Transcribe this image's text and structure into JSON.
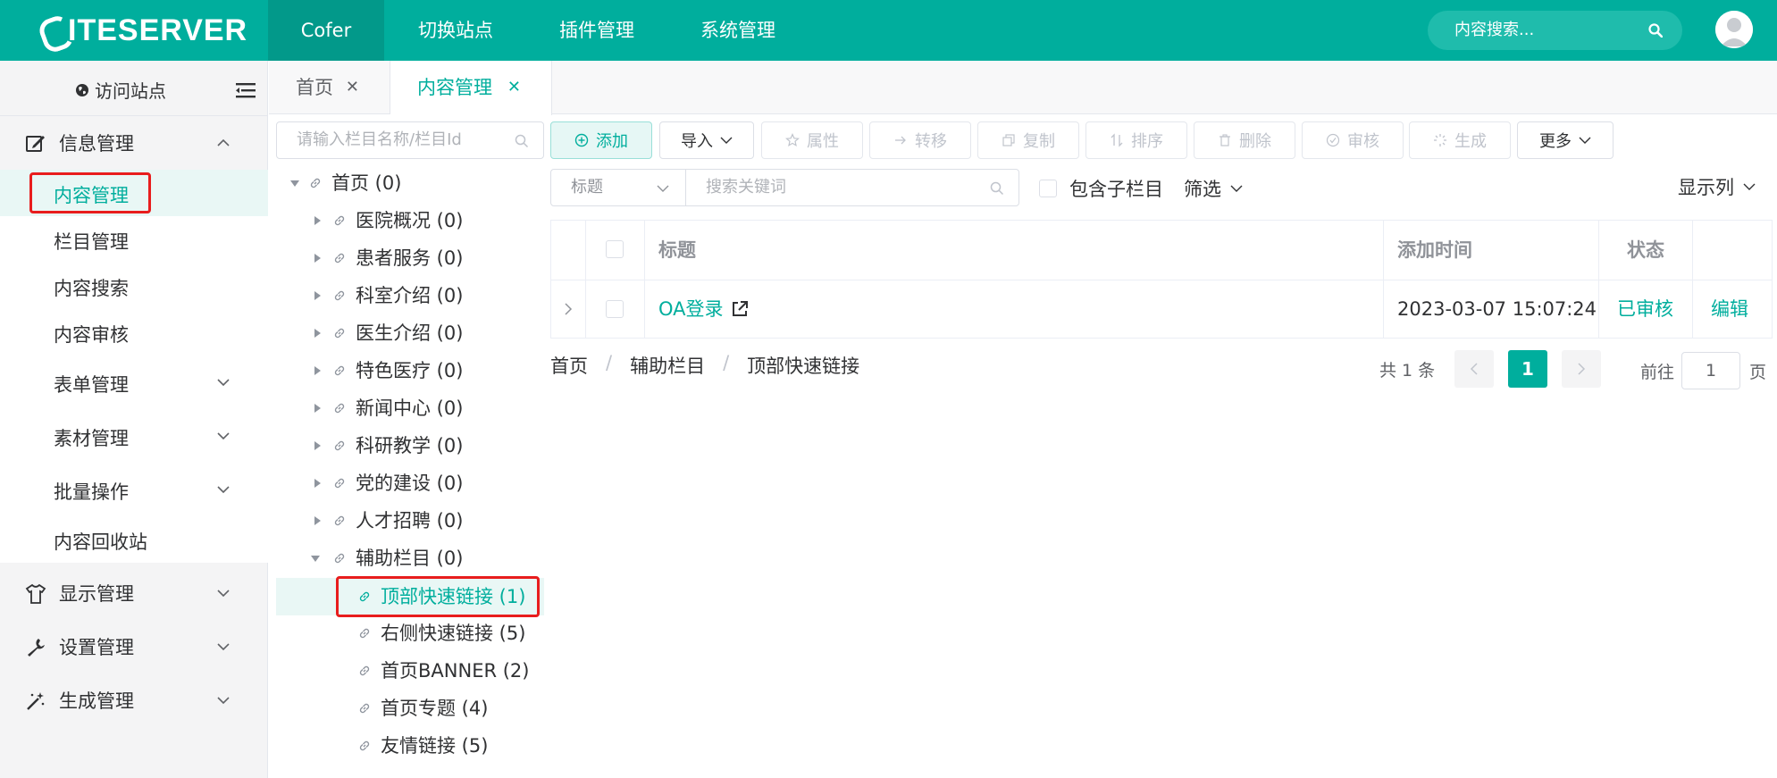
{
  "topbar": {
    "logo": "ITESERVER",
    "nav": [
      "Cofer",
      "切换站点",
      "插件管理",
      "系统管理"
    ],
    "search_placeholder": "内容搜索..."
  },
  "sidebar": {
    "visit_site": "访问站点",
    "groups": [
      {
        "label": "信息管理",
        "icon": "edit-icon",
        "expanded": true
      },
      {
        "label": "显示管理",
        "icon": "shirt-icon"
      },
      {
        "label": "设置管理",
        "icon": "wrench-icon"
      },
      {
        "label": "生成管理",
        "icon": "magic-wand-icon"
      }
    ],
    "sub_items": [
      "内容管理",
      "栏目管理",
      "内容搜索",
      "内容审核",
      "表单管理",
      "素材管理",
      "批量操作",
      "内容回收站"
    ]
  },
  "tabs": [
    {
      "label": "首页",
      "active": false
    },
    {
      "label": "内容管理",
      "active": true
    }
  ],
  "tree": {
    "search_placeholder": "请输入栏目名称/栏目Id",
    "nodes": [
      "首页 (0)",
      "医院概况 (0)",
      "患者服务 (0)",
      "科室介绍 (0)",
      "医生介绍 (0)",
      "特色医疗 (0)",
      "新闻中心 (0)",
      "科研教学 (0)",
      "党的建设 (0)",
      "人才招聘 (0)",
      "辅助栏目 (0)",
      "顶部快速链接 (1)",
      "右侧快速链接 (5)",
      "首页BANNER (2)",
      "首页专题 (4)",
      "友情链接 (5)"
    ]
  },
  "toolbar": {
    "add": "添加",
    "import": "导入",
    "attributes": "属性",
    "transfer": "转移",
    "copy": "复制",
    "sort": "排序",
    "delete": "删除",
    "review": "审核",
    "generate": "生成",
    "more": "更多"
  },
  "filter": {
    "field": "标题",
    "keyword_placeholder": "搜索关键词",
    "include_sub": "包含子栏目",
    "filter": "筛选",
    "columns": "显示列"
  },
  "table": {
    "headers": {
      "title": "标题",
      "added": "添加时间",
      "status": "状态"
    },
    "rows": [
      {
        "title": "OA登录",
        "added": "2023-03-07 15:07:24",
        "status": "已审核",
        "action": "编辑"
      }
    ]
  },
  "breadcrumb": [
    "首页",
    "辅助栏目",
    "顶部快速链接"
  ],
  "pager": {
    "total": "共 1 条",
    "page": "1",
    "goto_label": "前往",
    "goto_value": "1",
    "goto_suffix": "页"
  },
  "colors": {
    "accent": "#00ae9d",
    "highlight": "#e81d1d"
  }
}
